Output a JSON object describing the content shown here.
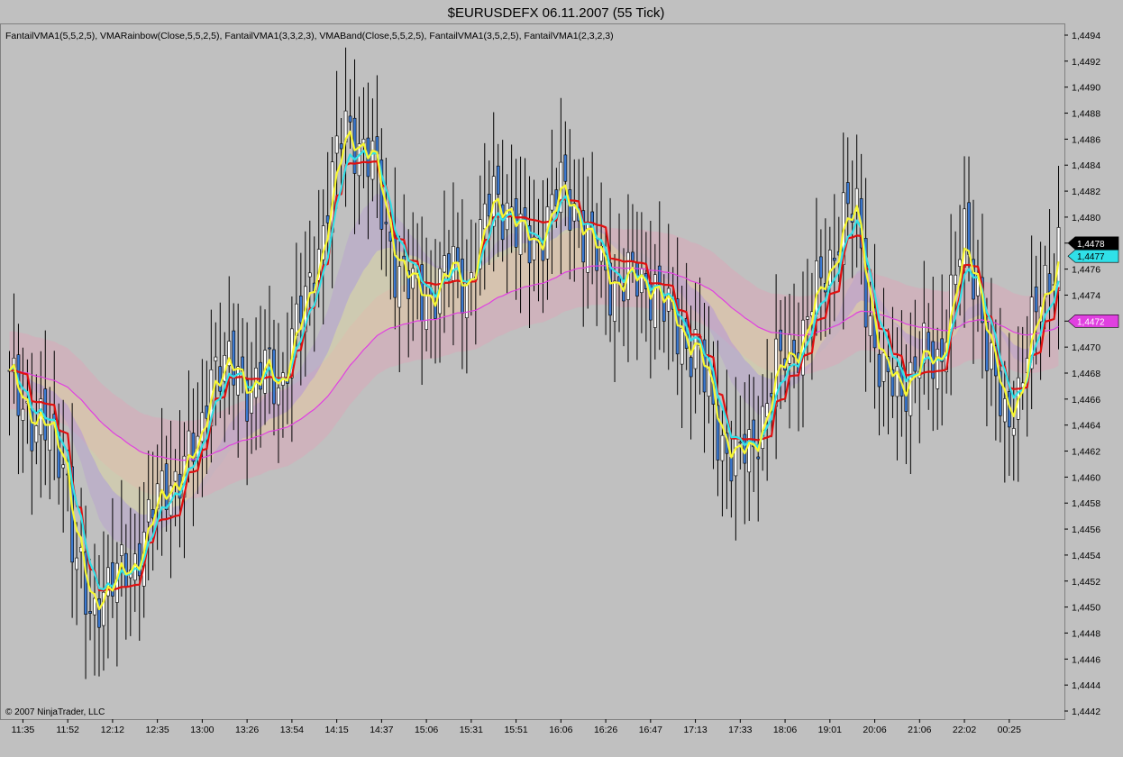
{
  "window": {
    "title": "$EURUSDEFX  06.11.2007  (55 Tick)",
    "indicators": "FantailVMA1(5,5,2,5), VMARainbow(Close,5,5,2,5), FantailVMA1(3,3,2,3), VMABand(Close,5,5,2,5), FantailVMA1(3,5,2,5), FantailVMA1(2,3,2,3)",
    "copyright": "© 2007 NinjaTrader, LLC"
  },
  "colors": {
    "background": "#c0c0c0",
    "bull_candle": "#ffffff",
    "bear_candle": "#3a78d0",
    "line_red": "#e01010",
    "line_yellow": "#f8f830",
    "line_cyan": "#30e0e8",
    "line_magenta": "#e040e0",
    "band_pink": "#d8a8b8",
    "band_yellow": "#e0d8a0",
    "band_violet": "#b8a0d0"
  },
  "price_markers": [
    {
      "value": "1,4478",
      "bg": "#000000",
      "fg": "#ffffff"
    },
    {
      "value": "1,4477",
      "bg": "#30e0e8",
      "fg": "#000000"
    },
    {
      "value": "1,4472",
      "bg": "#e040e0",
      "fg": "#ffffff"
    }
  ],
  "chart_data": {
    "type": "candlestick",
    "symbol": "$EURUSDEFX",
    "date": "06.11.2007",
    "interval": "55 Tick",
    "ylim": [
      1.4442,
      1.4495
    ],
    "y_ticks": [
      "1,4494",
      "1,4492",
      "1,4490",
      "1,4488",
      "1,4486",
      "1,4484",
      "1,4482",
      "1,4480",
      "1,4478",
      "1,4476",
      "1,4474",
      "1,4472",
      "1,4470",
      "1,4468",
      "1,4466",
      "1,4464",
      "1,4462",
      "1,4460",
      "1,4458",
      "1,4456",
      "1,4454",
      "1,4452",
      "1,4450",
      "1,4448",
      "1,4446",
      "1,4444",
      "1,4442"
    ],
    "x_ticks": [
      {
        "label": "11:35",
        "bar": 3
      },
      {
        "label": "11:52",
        "bar": 13
      },
      {
        "label": "12:12",
        "bar": 23
      },
      {
        "label": "12:35",
        "bar": 33
      },
      {
        "label": "13:00",
        "bar": 43
      },
      {
        "label": "13:26",
        "bar": 53
      },
      {
        "label": "13:54",
        "bar": 63
      },
      {
        "label": "14:15",
        "bar": 73
      },
      {
        "label": "14:37",
        "bar": 83
      },
      {
        "label": "15:06",
        "bar": 93
      },
      {
        "label": "15:31",
        "bar": 103
      },
      {
        "label": "15:51",
        "bar": 113
      },
      {
        "label": "16:06",
        "bar": 123
      },
      {
        "label": "16:26",
        "bar": 133
      },
      {
        "label": "16:47",
        "bar": 143
      },
      {
        "label": "17:13",
        "bar": 153
      },
      {
        "label": "17:33",
        "bar": 163
      },
      {
        "label": "18:06",
        "bar": 173
      },
      {
        "label": "19:01",
        "bar": 183
      },
      {
        "label": "20:06",
        "bar": 193
      },
      {
        "label": "21:06",
        "bar": 203
      },
      {
        "label": "22:02",
        "bar": 213
      },
      {
        "label": "00:25",
        "bar": 223
      }
    ],
    "close_anchors": [
      [
        0,
        1.4467
      ],
      [
        3,
        1.4466
      ],
      [
        6,
        1.4464
      ],
      [
        9,
        1.4463
      ],
      [
        12,
        1.4462
      ],
      [
        15,
        1.4453
      ],
      [
        18,
        1.4449
      ],
      [
        21,
        1.4452
      ],
      [
        24,
        1.4452
      ],
      [
        27,
        1.4453
      ],
      [
        30,
        1.4456
      ],
      [
        33,
        1.4458
      ],
      [
        36,
        1.446
      ],
      [
        39,
        1.4461
      ],
      [
        42,
        1.4462
      ],
      [
        45,
        1.4469
      ],
      [
        48,
        1.4468
      ],
      [
        51,
        1.4468
      ],
      [
        54,
        1.4467
      ],
      [
        57,
        1.4468
      ],
      [
        60,
        1.4467
      ],
      [
        63,
        1.4471
      ],
      [
        66,
        1.4473
      ],
      [
        69,
        1.4478
      ],
      [
        72,
        1.4483
      ],
      [
        75,
        1.4487
      ],
      [
        78,
        1.4486
      ],
      [
        81,
        1.4484
      ],
      [
        84,
        1.4479
      ],
      [
        87,
        1.4476
      ],
      [
        90,
        1.4474
      ],
      [
        93,
        1.4474
      ],
      [
        96,
        1.4475
      ],
      [
        99,
        1.4476
      ],
      [
        102,
        1.4475
      ],
      [
        105,
        1.4478
      ],
      [
        108,
        1.4482
      ],
      [
        111,
        1.4481
      ],
      [
        114,
        1.4478
      ],
      [
        117,
        1.4478
      ],
      [
        120,
        1.448
      ],
      [
        123,
        1.4482
      ],
      [
        126,
        1.4481
      ],
      [
        129,
        1.4478
      ],
      [
        132,
        1.4476
      ],
      [
        135,
        1.4475
      ],
      [
        138,
        1.4475
      ],
      [
        141,
        1.4475
      ],
      [
        144,
        1.4475
      ],
      [
        147,
        1.4472
      ],
      [
        150,
        1.4471
      ],
      [
        153,
        1.447
      ],
      [
        156,
        1.4466
      ],
      [
        159,
        1.4463
      ],
      [
        162,
        1.4461
      ],
      [
        165,
        1.4462
      ],
      [
        168,
        1.4465
      ],
      [
        171,
        1.4468
      ],
      [
        174,
        1.447
      ],
      [
        177,
        1.4471
      ],
      [
        180,
        1.4474
      ],
      [
        183,
        1.4477
      ],
      [
        186,
        1.448
      ],
      [
        189,
        1.448
      ],
      [
        192,
        1.4472
      ],
      [
        195,
        1.4467
      ],
      [
        198,
        1.4467
      ],
      [
        201,
        1.4468
      ],
      [
        204,
        1.4469
      ],
      [
        207,
        1.4469
      ],
      [
        210,
        1.4474
      ],
      [
        213,
        1.4478
      ],
      [
        216,
        1.4475
      ],
      [
        219,
        1.4468
      ],
      [
        222,
        1.4464
      ],
      [
        225,
        1.4467
      ],
      [
        228,
        1.4471
      ],
      [
        231,
        1.4475
      ],
      [
        234,
        1.4478
      ]
    ],
    "bar_count": 235,
    "series": [
      {
        "color": "red",
        "smoothing": 0.08
      },
      {
        "color": "yellow",
        "smoothing": 0.45
      },
      {
        "color": "cyan",
        "smoothing": 0.28
      },
      {
        "color": "magenta",
        "smoothing": 0.02
      }
    ]
  }
}
